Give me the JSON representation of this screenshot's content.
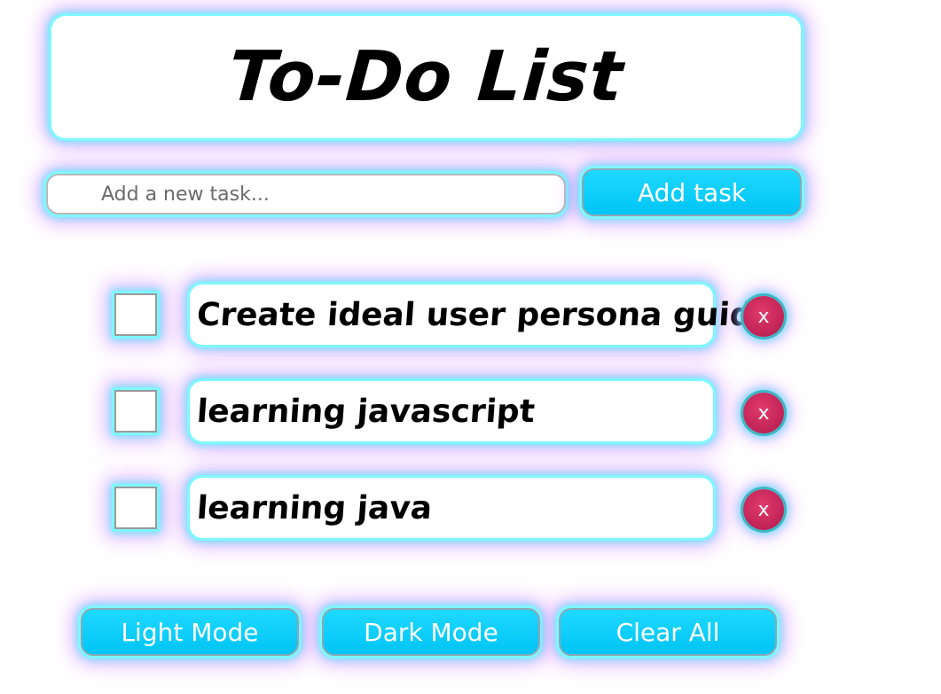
{
  "header": {
    "title": "To-Do List"
  },
  "new_task": {
    "placeholder": "Add a new task...",
    "value": ""
  },
  "buttons": {
    "add_task": "Add task",
    "light_mode": "Light Mode",
    "dark_mode": "Dark Mode",
    "clear_all": "Clear All"
  },
  "tasks": [
    {
      "text": "Create ideal user persona guide",
      "checked": false,
      "delete_label": "x"
    },
    {
      "text": "learning javascript",
      "checked": false,
      "delete_label": "x"
    },
    {
      "text": "learning java",
      "checked": false,
      "delete_label": "x"
    }
  ],
  "colors": {
    "accent": "#00c4f5",
    "glow_cyan": "#7ff7ff",
    "glow_purple": "#d278ff",
    "delete_red": "#c4265a"
  }
}
